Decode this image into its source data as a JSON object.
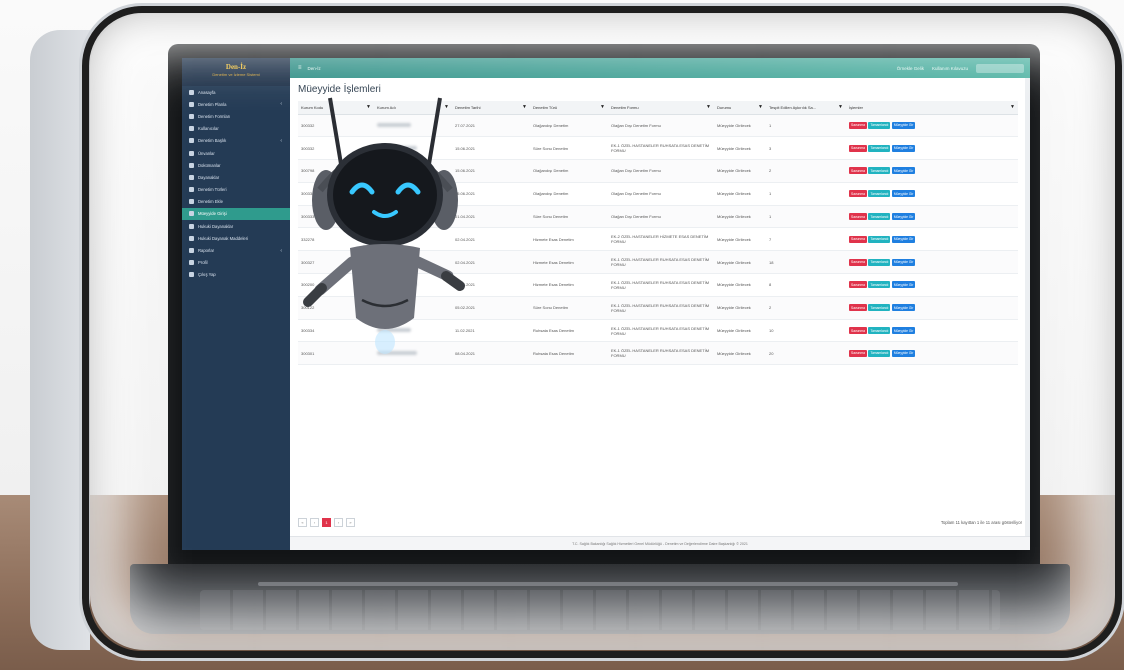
{
  "app": {
    "brand_title": "Den-İz",
    "brand_subtitle": "Denetim ve İzleme Sistemi",
    "breadcrumb": "Den-İz",
    "page_title": "Müeyyide İşlemleri",
    "topbar_links": [
      "Örnekle Gelik",
      "Kullanım Kılavuzu"
    ]
  },
  "sidebar": {
    "items": [
      {
        "label": "Anasayfa",
        "arrow": false,
        "active": false
      },
      {
        "label": "Denetim Planla",
        "arrow": true,
        "active": false
      },
      {
        "label": "Denetim Formları",
        "arrow": false,
        "active": false
      },
      {
        "label": "Kullanıcılar",
        "arrow": false,
        "active": false
      },
      {
        "label": "Denetim Başlık",
        "arrow": true,
        "active": false
      },
      {
        "label": "Ünvanlar",
        "arrow": false,
        "active": false
      },
      {
        "label": "Dokümanlar",
        "arrow": false,
        "active": false
      },
      {
        "label": "Dayanaklar",
        "arrow": false,
        "active": false
      },
      {
        "label": "Denetim Türleri",
        "arrow": false,
        "active": false
      },
      {
        "label": "Denetim Ekle",
        "arrow": false,
        "active": false
      },
      {
        "label": "Müeyyide Girişi",
        "arrow": false,
        "active": true
      },
      {
        "label": "Hukuki Dayanaklar",
        "arrow": false,
        "active": false
      },
      {
        "label": "Hukuki Dayanak Maddeleri",
        "arrow": false,
        "active": false
      },
      {
        "label": "Raporlar",
        "arrow": true,
        "active": false
      },
      {
        "label": "Profil",
        "arrow": false,
        "active": false
      },
      {
        "label": "Çıkış Yap",
        "arrow": false,
        "active": false
      }
    ]
  },
  "table": {
    "headers": [
      "Kurum Kodu",
      "Kurum Adı",
      "Denetim Tarihi",
      "Denetim Türü",
      "Denetim Formu",
      "Durumu",
      "Tespit Edilen Aykırılık Sa...",
      "İşlemler"
    ],
    "rows": [
      {
        "code": "300332",
        "date": "27.07.2021",
        "type": "Olağandışı Denetim",
        "form": "Olağan Dışı Denetim Formu",
        "status": "Müeyyide Girilecek",
        "count": "1"
      },
      {
        "code": "300332",
        "date": "15.06.2021",
        "type": "Süre Sonu Denetim",
        "form": "EK-1 ÖZEL HASTANELER RUHSATA ESAS DENETİM FORMU",
        "status": "Müeyyide Girilecek",
        "count": "3"
      },
      {
        "code": "300798",
        "date": "15.06.2021",
        "type": "Olağandışı Denetim",
        "form": "Olağan Dışı Denetim Formu",
        "status": "Müeyyide Girilecek",
        "count": "2"
      },
      {
        "code": "300332",
        "date": "15.06.2021",
        "type": "Olağandışı Denetim",
        "form": "Olağan Dışı Denetim Formu",
        "status": "Müeyyide Girilecek",
        "count": "1"
      },
      {
        "code": "300333",
        "date": "01.04.2021",
        "type": "Süre Sonu Denetim",
        "form": "Olağan Dışı Denetim Formu",
        "status": "Müeyyide Girilecek",
        "count": "1"
      },
      {
        "code": "332278",
        "date": "02.04.2021",
        "type": "Hizmete Esas Denetim",
        "form": "EK-2 ÖZEL HASTANELER HİZMETE ESAS DENETİM FORMU",
        "status": "Müeyyide Girilecek",
        "count": "7"
      },
      {
        "code": "300327",
        "date": "02.04.2021",
        "type": "Hizmete Esas Denetim",
        "form": "EK-1 ÖZEL HASTANELER RUHSATA ESAS DENETİM FORMU",
        "status": "Müeyyide Girilecek",
        "count": "18"
      },
      {
        "code": "300200",
        "date": "01.03.2021",
        "type": "Hizmete Esas Denetim",
        "form": "EK-1 ÖZEL HASTANELER RUHSATA ESAS DENETİM FORMU",
        "status": "Müeyyide Girilecek",
        "count": "8"
      },
      {
        "code": "300122",
        "date": "05.02.2021",
        "type": "Süre Sonu Denetim",
        "form": "EK-1 ÖZEL HASTANELER RUHSATA ESAS DENETİM FORMU",
        "status": "Müeyyide Girilecek",
        "count": "2"
      },
      {
        "code": "300334",
        "date": "11.02.2021",
        "type": "Ruhsata Esas Denetim",
        "form": "EK-1 ÖZEL HASTANELER RUHSATA ESAS DENETİM FORMU",
        "status": "Müeyyide Girilecek",
        "count": "10"
      },
      {
        "code": "300301",
        "date": "08.04.2021",
        "type": "Ruhsata Esas Denetim",
        "form": "EK-1 ÖZEL HASTANELER RUHSATA ESAS DENETİM FORMU",
        "status": "Müeyyide Girilecek",
        "count": "20"
      }
    ],
    "actions": [
      "Savunma",
      "Tamamlandı",
      "Müeyyide Gir"
    ]
  },
  "pagination": {
    "buttons": [
      "«",
      "‹",
      "1",
      "›",
      "»"
    ],
    "active_page": "1",
    "total_text": "Toplam 11 kayıttan 1 ile 11 arası gösteriliyor"
  },
  "footer": {
    "text": "T.C. Sağlık Bakanlığı Sağlık Hizmetleri Genel Müdürlüğü - Denetim ve Değerlendirme Daire Başkanlığı © 2021"
  },
  "colors": {
    "sidebar": "#243b55",
    "topbar": "#2f8f86",
    "active_item": "#2f9b8d",
    "btn_red": "#e0334b",
    "btn_teal": "#21b3c0",
    "btn_blue": "#1f7fe0"
  }
}
